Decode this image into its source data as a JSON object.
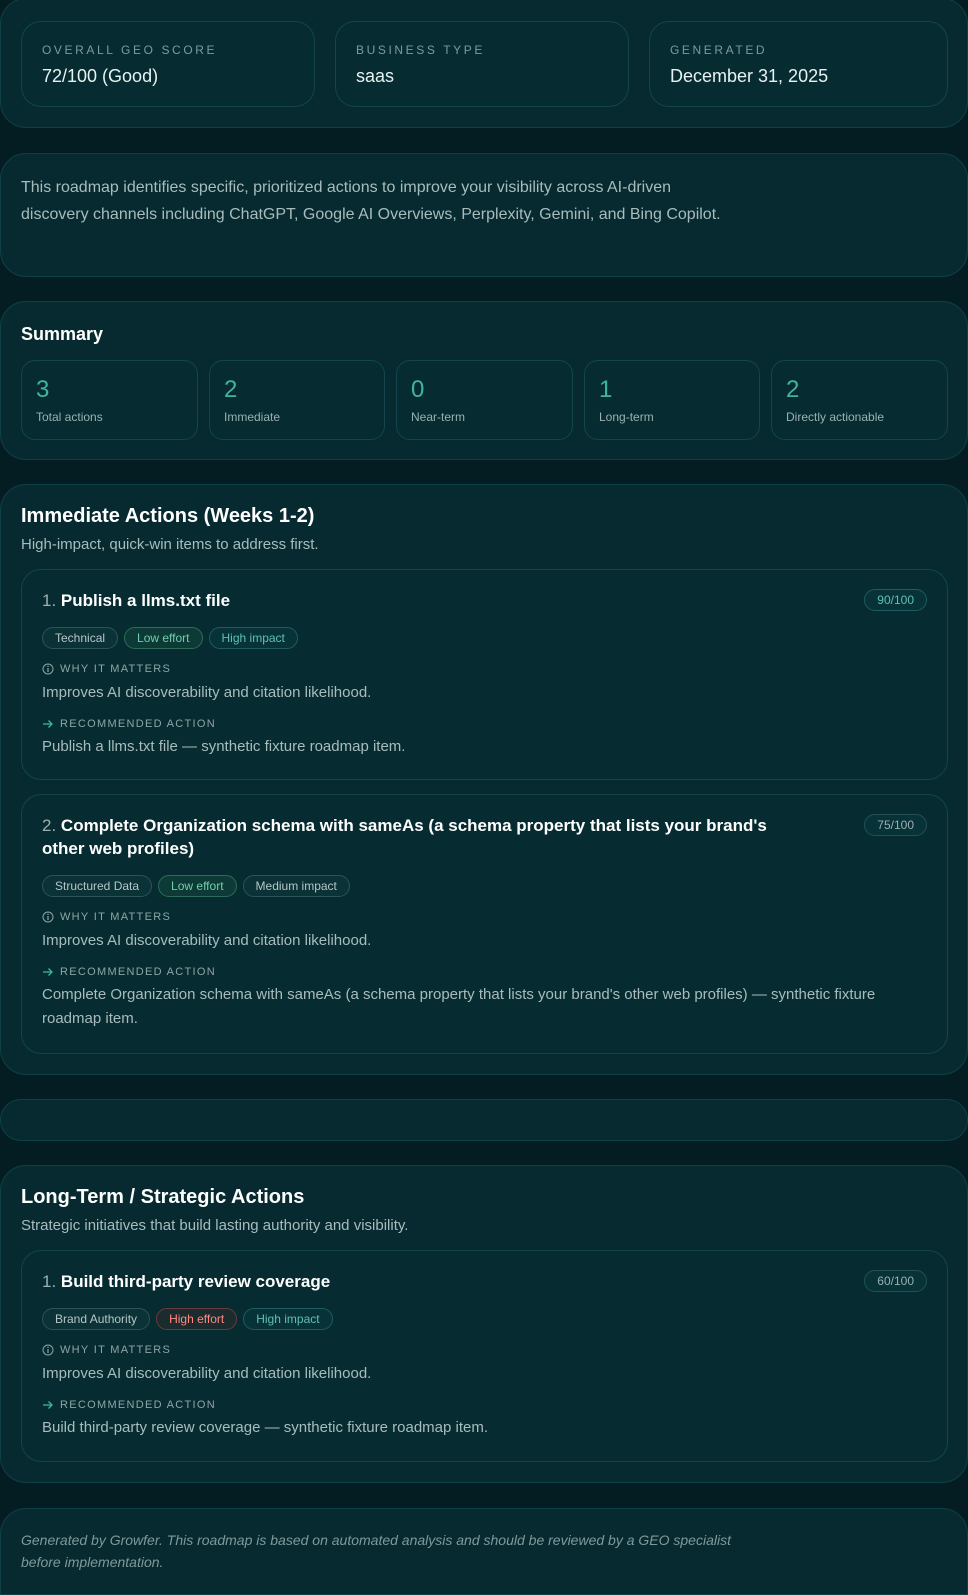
{
  "header": {
    "score_label": "OVERALL GEO SCORE",
    "score_value": "72/100 (Good)",
    "type_label": "BUSINESS TYPE",
    "type_value": "saas",
    "generated_label": "GENERATED",
    "generated_value": "December 31, 2025"
  },
  "intro": "This roadmap identifies specific, prioritized actions to improve your visibility across AI-driven discovery channels including ChatGPT, Google AI Overviews, Perplexity, Gemini, and Bing Copilot.",
  "summary": {
    "title": "Summary",
    "stats": [
      {
        "value": "3",
        "label": "Total actions"
      },
      {
        "value": "2",
        "label": "Immediate"
      },
      {
        "value": "0",
        "label": "Near-term"
      },
      {
        "value": "1",
        "label": "Long-term"
      },
      {
        "value": "2",
        "label": "Directly actionable"
      }
    ]
  },
  "immediate": {
    "title": "Immediate Actions (Weeks 1-2)",
    "subtitle": "High-impact, quick-win items to address first.",
    "items": [
      {
        "index": "1.",
        "title": "Publish a llms.txt file",
        "score": "90/100",
        "tags": [
          "Technical",
          "Low effort",
          "High impact"
        ],
        "why_label": "WHY IT MATTERS",
        "why": "Improves AI discoverability and citation likelihood.",
        "action_label": "RECOMMENDED ACTION",
        "action": "Publish a llms.txt file — synthetic fixture roadmap item."
      },
      {
        "index": "2.",
        "title": "Complete Organization schema with sameAs (a schema property that lists your brand's other web profiles)",
        "score": "75/100",
        "tags": [
          "Structured Data",
          "Low effort",
          "Medium impact"
        ],
        "why_label": "WHY IT MATTERS",
        "why": "Improves AI discoverability and citation likelihood.",
        "action_label": "RECOMMENDED ACTION",
        "action": "Complete Organization schema with sameAs (a schema property that lists your brand's other web profiles) — synthetic fixture roadmap item."
      }
    ]
  },
  "long_term": {
    "title": "Long-Term / Strategic Actions",
    "subtitle": "Strategic initiatives that build lasting authority and visibility.",
    "items": [
      {
        "index": "1.",
        "title": "Build third-party review coverage",
        "score": "60/100",
        "tags": [
          "Brand Authority",
          "High effort",
          "High impact"
        ],
        "why_label": "WHY IT MATTERS",
        "why": "Improves AI discoverability and citation likelihood.",
        "action_label": "RECOMMENDED ACTION",
        "action": "Build third-party review coverage — synthetic fixture roadmap item."
      }
    ]
  },
  "footer": "Generated by Growfer. This roadmap is based on automated analysis and should be reviewed by a GEO specialist before implementation.",
  "colors": {
    "background": "#041d22",
    "card": "#062a30",
    "accent": "#3fb5a0",
    "low_effort": "#6fd0a8",
    "high_effort": "#ff8a80"
  }
}
